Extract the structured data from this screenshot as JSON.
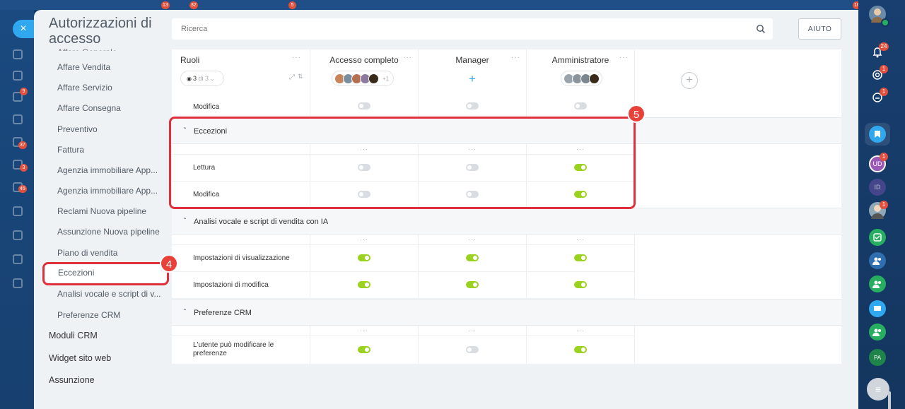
{
  "panel": {
    "title": "Autorizzazioni di accesso"
  },
  "search": {
    "placeholder": "Ricerca"
  },
  "help": {
    "label": "AIUTO"
  },
  "sidebar": {
    "cut_item": "Affare Generale",
    "items": [
      "Affare Vendita",
      "Affare Servizio",
      "Affare Consegna",
      "Preventivo",
      "Fattura",
      "Agenzia immobiliare App...",
      "Agenzia immobiliare App...",
      "Reclami Nuova pipeline",
      "Assunzione Nuova pipeline",
      "Piano di vendita",
      "Eccezioni",
      "Analisi vocale e script di v...",
      "Preferenze CRM"
    ],
    "active_item": "Eccezioni",
    "top_items": [
      "Moduli CRM",
      "Widget sito web",
      "Assunzione"
    ]
  },
  "table": {
    "roles_header": "Ruoli",
    "role_filter": "3",
    "role_filter_suffix": "di 3",
    "columns": [
      {
        "name": "Accesso completo",
        "extra_count": "+1"
      },
      {
        "name": "Manager"
      },
      {
        "name": "Amministratore"
      }
    ],
    "rows_before": [
      {
        "label": "Modifica",
        "values": [
          false,
          false,
          false
        ]
      }
    ],
    "sections": [
      {
        "title": "Eccezioni",
        "rows": [
          {
            "label": "Lettura",
            "values": [
              false,
              false,
              true
            ]
          },
          {
            "label": "Modifica",
            "values": [
              false,
              false,
              true
            ]
          }
        ]
      },
      {
        "title": "Analisi vocale e script di vendita con IA",
        "rows": [
          {
            "label": "Impostazioni di visualizzazione",
            "values": [
              true,
              true,
              true
            ]
          },
          {
            "label": "Impostazioni di modifica",
            "values": [
              true,
              true,
              true
            ]
          }
        ]
      },
      {
        "title": "Preferenze CRM",
        "rows": [
          {
            "label": "L'utente può modificare le preferenze",
            "values": [
              true,
              false,
              true
            ]
          }
        ]
      }
    ]
  },
  "annotations": [
    {
      "number": "4",
      "target": "Eccezioni (sidebar)"
    },
    {
      "number": "5",
      "target": "Eccezioni (section)"
    }
  ],
  "right_rail": {
    "badges": [
      "24",
      "1",
      "1",
      "1",
      "1"
    ],
    "initials": [
      "UD",
      "ID",
      "PA"
    ]
  },
  "background_badges": [
    "32",
    "9",
    "5",
    "37",
    "3",
    "45",
    "16"
  ],
  "colors": {
    "toggle_on": "#9bd21f",
    "toggle_off": "#d9dde1",
    "accent": "#2fa8f0",
    "annotation": "#e0303c"
  }
}
